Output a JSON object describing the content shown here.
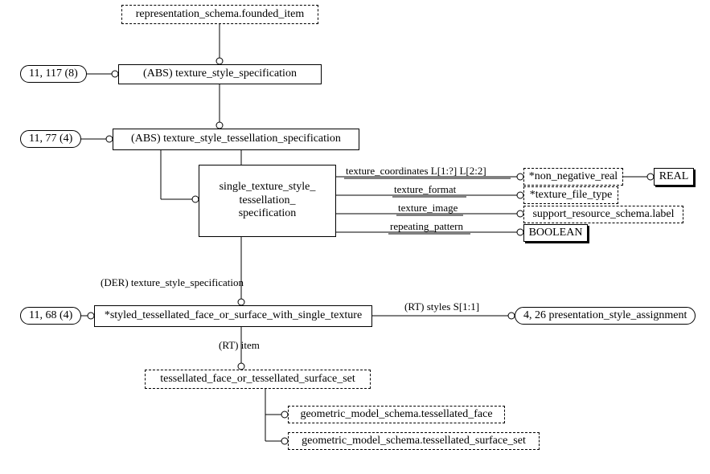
{
  "chart_data": {
    "type": "diagram",
    "title": "EXPRESS-G diagram",
    "nodes": [
      {
        "id": "rep_schema",
        "label": "representation_schema.founded_item",
        "style": "dashed"
      },
      {
        "id": "ref_1",
        "label": "11, 117 (8)",
        "style": "pill"
      },
      {
        "id": "tss",
        "label": "(ABS) texture_style_specification",
        "style": "solid"
      },
      {
        "id": "ref_2",
        "label": "11, 77 (4)",
        "style": "pill"
      },
      {
        "id": "tsts",
        "label": "(ABS) texture_style_tessellation_specification",
        "style": "solid"
      },
      {
        "id": "ststs",
        "label": "single_texture_style_ tessellation_ specification",
        "style": "solid"
      },
      {
        "id": "nnr",
        "label": "*non_negative_real",
        "style": "dashed"
      },
      {
        "id": "real",
        "label": "REAL",
        "style": "shadow"
      },
      {
        "id": "tft",
        "label": "*texture_file_type",
        "style": "dashed"
      },
      {
        "id": "srs_label",
        "label": "support_resource_schema.label",
        "style": "dashed"
      },
      {
        "id": "boolean",
        "label": "BOOLEAN",
        "style": "shadow"
      },
      {
        "id": "ref_3",
        "label": "11, 68 (4)",
        "style": "pill"
      },
      {
        "id": "stfos",
        "label": "*styled_tessellated_face_or_surface_with_single_texture",
        "style": "solid"
      },
      {
        "id": "psa",
        "label": "4, 26 presentation_style_assignment",
        "style": "pill"
      },
      {
        "id": "tfotss",
        "label": "tessellated_face_or_tessellated_surface_set",
        "style": "dashed"
      },
      {
        "id": "gms_tf",
        "label": "geometric_model_schema.tessellated_face",
        "style": "dashed"
      },
      {
        "id": "gms_tss",
        "label": "geometric_model_schema.tessellated_surface_set",
        "style": "dashed"
      }
    ],
    "edges": [
      {
        "from": "rep_schema",
        "to": "tss",
        "label": ""
      },
      {
        "from": "ref_1",
        "to": "tss",
        "label": ""
      },
      {
        "from": "tss",
        "to": "tsts",
        "label": ""
      },
      {
        "from": "ref_2",
        "to": "tsts",
        "label": ""
      },
      {
        "from": "tsts",
        "to": "ststs",
        "label": ""
      },
      {
        "from": "ststs",
        "to": "nnr",
        "label": "texture_coordinates L[1:?] L[2:2]"
      },
      {
        "from": "nnr",
        "to": "real",
        "label": ""
      },
      {
        "from": "ststs",
        "to": "tft",
        "label": "texture_format"
      },
      {
        "from": "ststs",
        "to": "srs_label",
        "label": "texture_image"
      },
      {
        "from": "ststs",
        "to": "boolean",
        "label": "repeating_pattern"
      },
      {
        "from": "tsts",
        "to": "stfos",
        "label": "(DER) texture_style_specification"
      },
      {
        "from": "ref_3",
        "to": "stfos",
        "label": ""
      },
      {
        "from": "stfos",
        "to": "psa",
        "label": "(RT) styles S[1:1]"
      },
      {
        "from": "stfos",
        "to": "tfotss",
        "label": "(RT) item"
      },
      {
        "from": "tfotss",
        "to": "gms_tf",
        "label": ""
      },
      {
        "from": "tfotss",
        "to": "gms_tss",
        "label": ""
      }
    ]
  },
  "labels": {
    "rep_schema": "representation_schema.founded_item",
    "ref_1": "11, 117 (8)",
    "tss": "(ABS) texture_style_specification",
    "ref_2": "11, 77 (4)",
    "tsts": "(ABS) texture_style_tessellation_specification",
    "ststs_l1": "single_texture_style_",
    "ststs_l2": "tessellation_",
    "ststs_l3": "specification",
    "nnr": "*non_negative_real",
    "real": "REAL",
    "tft": "*texture_file_type",
    "srs_label": "support_resource_schema.label",
    "boolean": "BOOLEAN",
    "ref_3": "11, 68 (4)",
    "stfos": "*styled_tessellated_face_or_surface_with_single_texture",
    "psa": "4, 26 presentation_style_assignment",
    "tfotss": "tessellated_face_or_tessellated_surface_set",
    "gms_tf": "geometric_model_schema.tessellated_face",
    "gms_tss": "geometric_model_schema.tessellated_surface_set",
    "e_tex_coords": "texture_coordinates L[1:?] L[2:2]",
    "e_tex_format": "texture_format",
    "e_tex_image": "texture_image",
    "e_rep_pattern": "repeating_pattern",
    "e_der_tss": "(DER) texture_style_specification",
    "e_rt_item": "(RT) item",
    "e_rt_styles": "(RT) styles S[1:1]"
  }
}
